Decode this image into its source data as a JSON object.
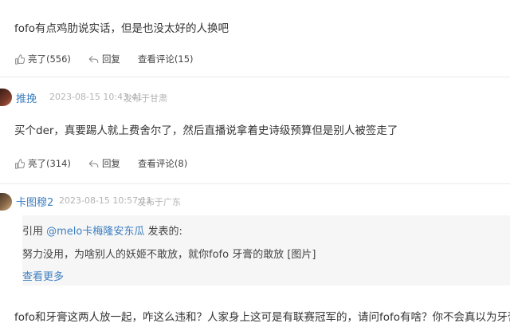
{
  "comments": [
    {
      "text": "fofo有点鸡肋说实话，但是也没太好的人换吧",
      "actions": {
        "like": "亮了(556)",
        "reply": "回复",
        "view": "查看评论(15)"
      }
    },
    {
      "user": "推挽",
      "time": "2023-08-15 10:43:41",
      "location": "发布于甘肃",
      "text": "买个der，真要踢人就上费舍尔了，然后直播说拿着史诗级预算但是别人被签走了",
      "actions": {
        "like": "亮了(314)",
        "reply": "回复",
        "view": "查看评论(8)"
      }
    },
    {
      "user": "卡图穆2",
      "time": "2023-08-15 10:57:11",
      "location": "发布于广东",
      "quote": {
        "prefix": "引用 ",
        "quoted_user": "@melo卡梅隆安东瓜",
        "suffix": " 发表的:",
        "content": "努力没用，为啥别人的妖姬不敢放，就你fofo 牙膏的敢放 [图片]",
        "more": "查看更多"
      },
      "text": "fofo和牙膏这两人放一起，咋这么违和？人家身上这可是有联赛冠军的，请问fofo有啥？你不会真以为牙膏菜"
    }
  ],
  "icons": {
    "like": "thumbs-up-icon",
    "reply": "reply-arrow-icon"
  },
  "colors": {
    "link": "#3d7fc1",
    "meta": "#b3b3b3",
    "quote_bg": "#f6f6f6"
  }
}
